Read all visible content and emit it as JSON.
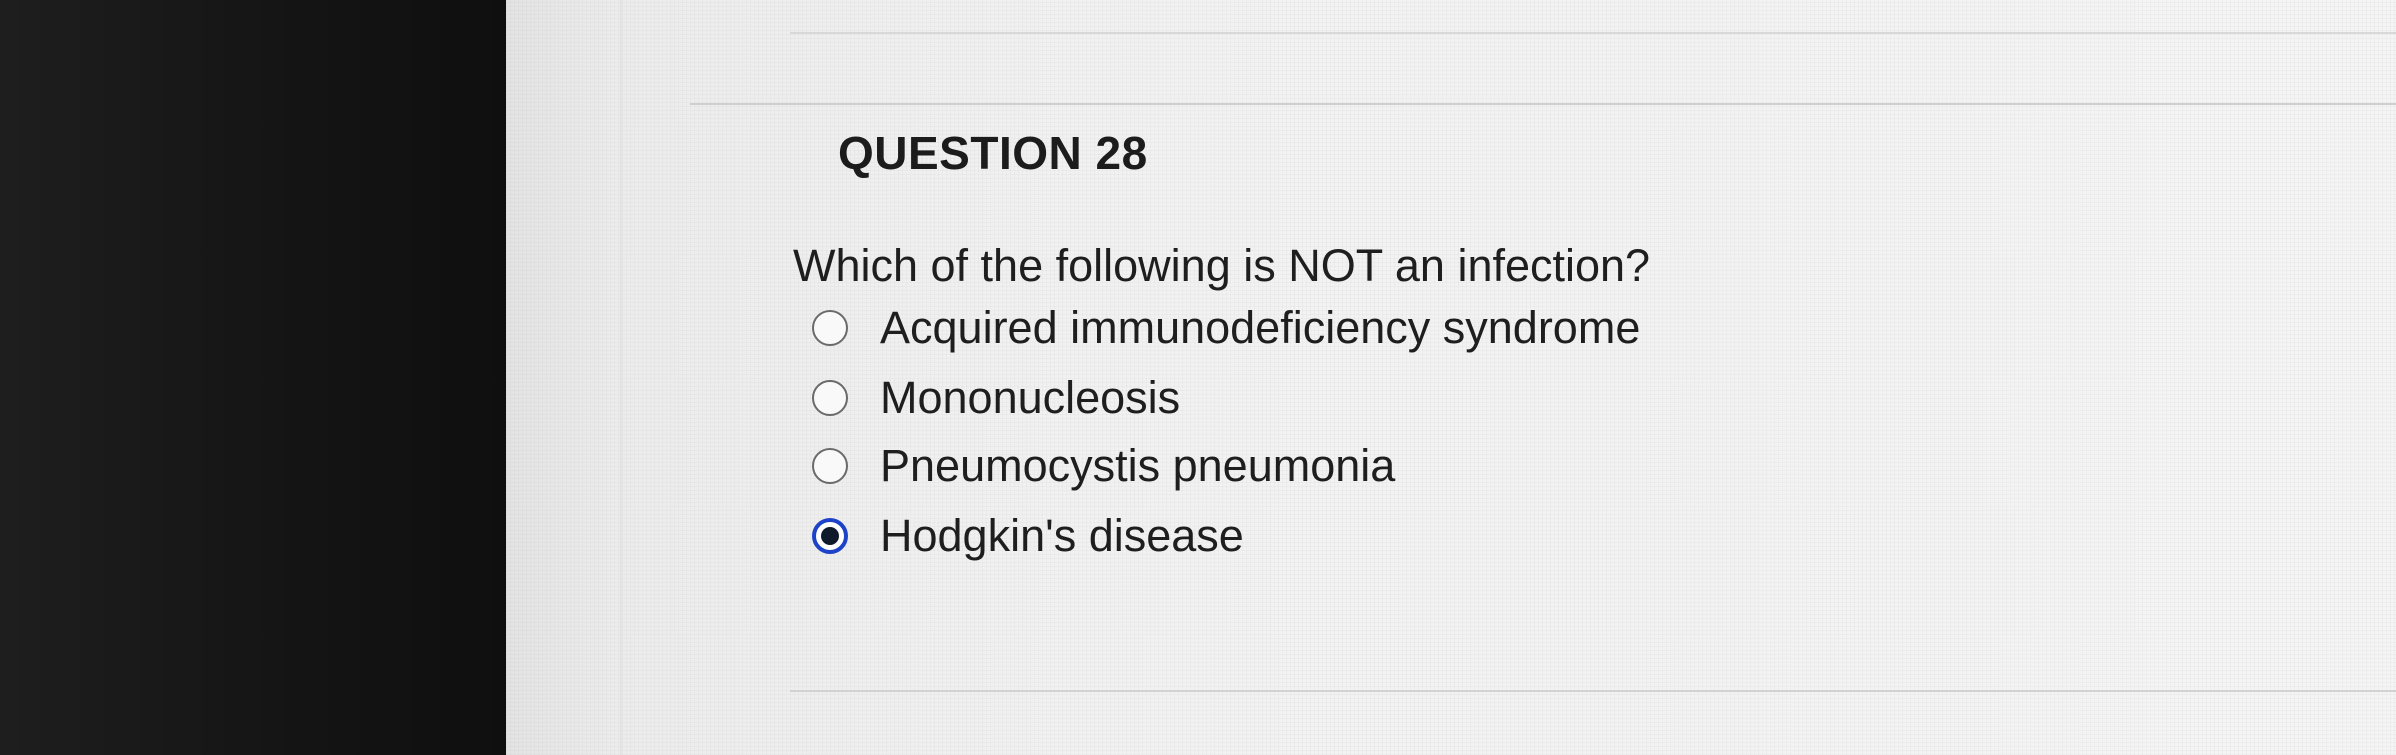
{
  "question": {
    "title": "QUESTION 28",
    "prompt": "Which of the following is NOT an infection?",
    "options": [
      {
        "label": "Acquired immunodeficiency syndrome",
        "selected": false
      },
      {
        "label": "Mononucleosis",
        "selected": false
      },
      {
        "label": "Pneumocystis pneumonia",
        "selected": false
      },
      {
        "label": "Hodgkin's disease",
        "selected": true
      }
    ]
  },
  "colors": {
    "selected_ring": "#1d43c8",
    "text": "#1e1e1e",
    "background": "#f1f1f1"
  }
}
